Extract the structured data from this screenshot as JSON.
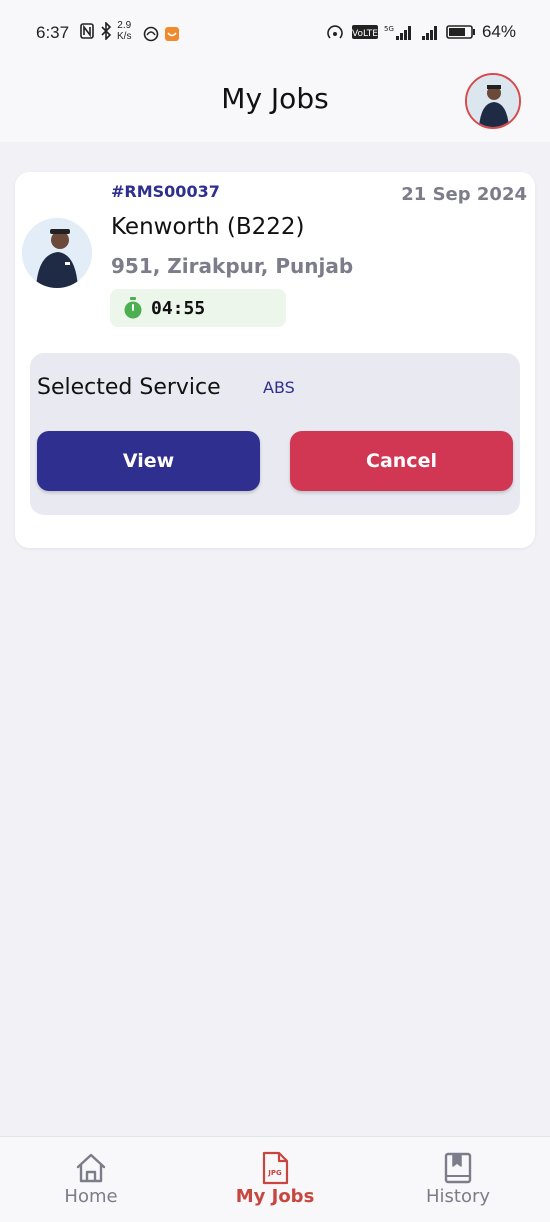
{
  "status_bar": {
    "time": "6:37",
    "network_speed_value": "2.9",
    "network_speed_unit": "K/s",
    "battery": "64%"
  },
  "header": {
    "title": "My Jobs"
  },
  "job": {
    "id": "#RMS00037",
    "date": "21 Sep 2024",
    "vehicle": "Kenworth (B222)",
    "address": "951, Zirakpur, Punjab",
    "timer": "04:55",
    "service_label": "Selected Service",
    "service_value": "ABS",
    "view_label": "View",
    "cancel_label": "Cancel"
  },
  "bottom_nav": {
    "items": [
      {
        "label": "Home",
        "icon": "home-icon"
      },
      {
        "label": "My Jobs",
        "icon": "jpg-document-icon",
        "icon_text": "JPG"
      },
      {
        "label": "History",
        "icon": "bookmark-book-icon"
      }
    ]
  },
  "colors": {
    "primary": "#2f2f8f",
    "danger": "#d13652",
    "active_nav": "#c8463e",
    "muted": "#7c7c8a",
    "background": "#f1f1f6"
  }
}
